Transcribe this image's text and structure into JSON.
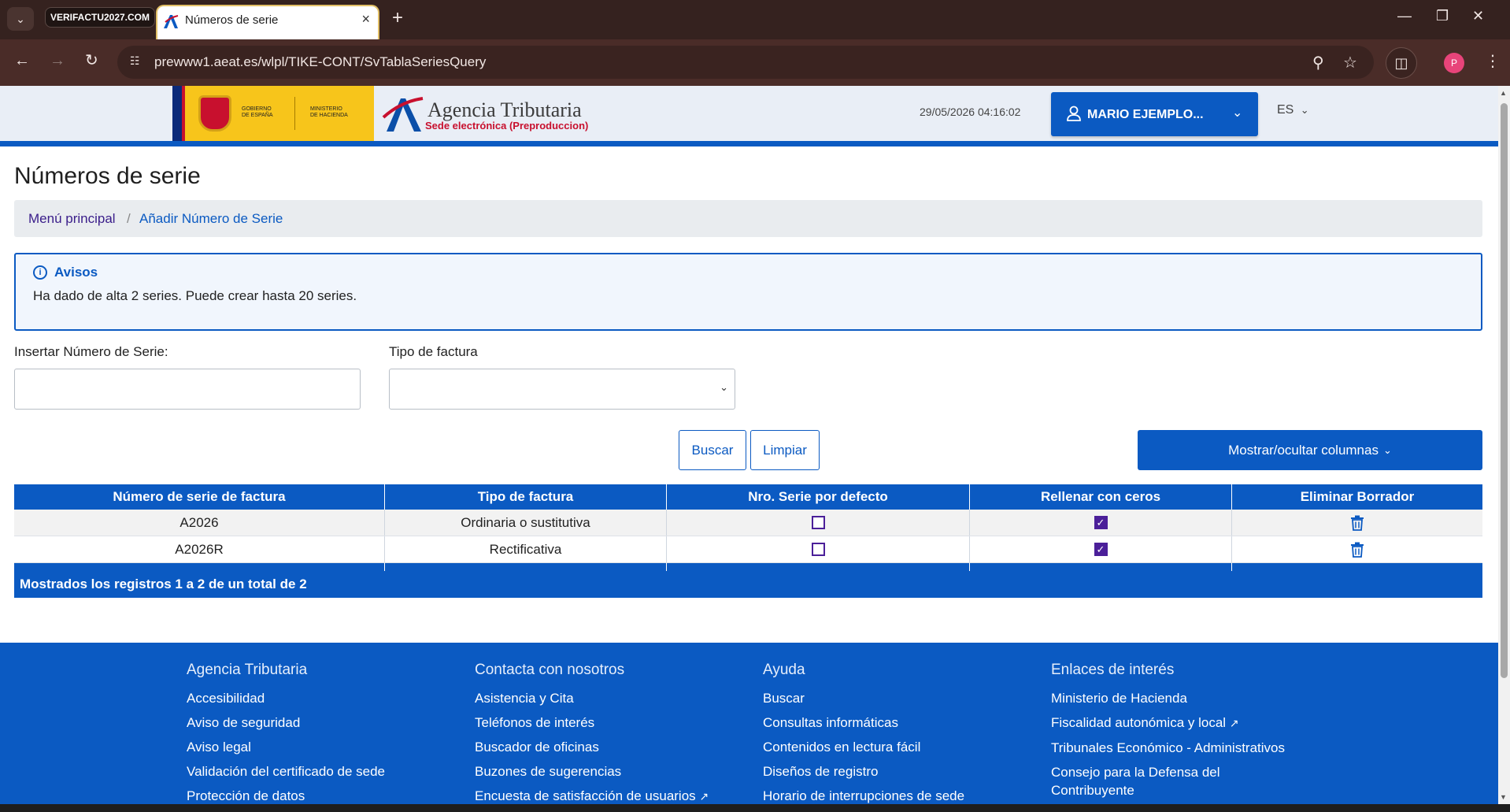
{
  "browser": {
    "extension_chip": "VERIFACTU2027.COM",
    "tab_title": "Números de serie",
    "url": "prewww1.aeat.es/wlpl/TIKE-CONT/SvTablaSeriesQuery",
    "avatar_letter": "P"
  },
  "header": {
    "gov_line1": "GOBIERNO",
    "gov_line2": "DE ESPAÑA",
    "ministry_line1": "MINISTERIO",
    "ministry_line2": "DE HACIENDA",
    "agency_name": "Agencia Tributaria",
    "agency_sub": "Sede electrónica (Preproduccion)",
    "datetime": "29/05/2026 04:16:02",
    "user_name": "MARIO EJEMPLO...",
    "language": "ES"
  },
  "page": {
    "title": "Números de serie",
    "breadcrumb": [
      "Menú principal",
      "Añadir Número de Serie"
    ],
    "alert_title": "Avisos",
    "alert_text": "Ha dado de alta 2 series. Puede crear hasta 20 series.",
    "serial_label": "Insertar Número de Serie:",
    "type_label": "Tipo de factura",
    "buscar": "Buscar",
    "limpiar": "Limpiar",
    "toggle_columns": "Mostrar/ocultar columnas"
  },
  "table": {
    "headers": [
      "Número de serie de factura",
      "Tipo de factura",
      "Nro. Serie por defecto",
      "Rellenar con ceros",
      "Eliminar Borrador"
    ],
    "rows": [
      {
        "serie": "A2026",
        "tipo": "Ordinaria o sustitutiva",
        "defecto": false,
        "ceros": true
      },
      {
        "serie": "A2026R",
        "tipo": "Rectificativa",
        "defecto": false,
        "ceros": true
      }
    ],
    "footer": "Mostrados los registros 1 a 2 de un total de 2"
  },
  "footer": {
    "col1": {
      "heading": "Agencia Tributaria",
      "links": [
        "Accesibilidad",
        "Aviso de seguridad",
        "Aviso legal",
        "Validación del certificado de sede",
        "Protección de datos"
      ]
    },
    "col2": {
      "heading": "Contacta con nosotros",
      "links": [
        "Asistencia y Cita",
        "Teléfonos de interés",
        "Buscador de oficinas",
        "Buzones de sugerencias",
        "Encuesta de satisfacción de usuarios"
      ]
    },
    "col3": {
      "heading": "Ayuda",
      "links": [
        "Buscar",
        "Consultas informáticas",
        "Contenidos en lectura fácil",
        "Diseños de registro",
        "Horario de interrupciones de sede"
      ]
    },
    "col4": {
      "heading": "Enlaces de interés",
      "links": [
        "Ministerio de Hacienda",
        "Fiscalidad autonómica y local",
        "Tribunales Económico - Administrativos",
        "Consejo para la Defensa del Contribuyente"
      ]
    }
  },
  "colors": {
    "primary": "#0b5ac2",
    "checkbox": "#4b1f99",
    "chrome": "#35221f"
  }
}
